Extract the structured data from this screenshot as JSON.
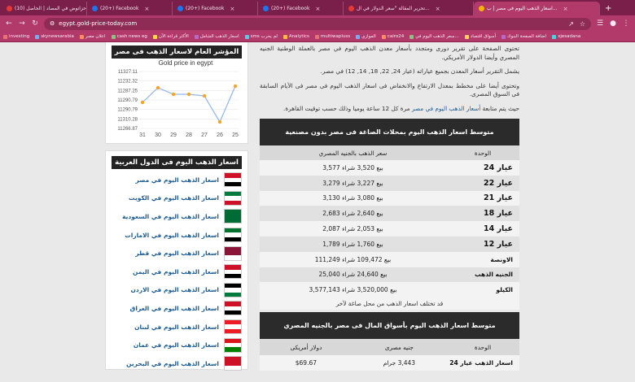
{
  "browser": {
    "tabs": [
      {
        "label": "(10) حزاتوض في المصاد | الحاصل...",
        "color": "#e53935"
      },
      {
        "label": "(20+) Facebook",
        "color": "#1877f2"
      },
      {
        "label": "(20+) Facebook",
        "color": "#1877f2"
      },
      {
        "label": "(20+) Facebook",
        "color": "#1877f2"
      },
      {
        "label": "تحرير المقالة \"سعر الدولار في ال...",
        "color": "#e53935"
      },
      {
        "label": "اسعار الذهب اليوم فى مصر | ب...",
        "color": "#f5b300"
      }
    ],
    "url": "egypt.gold-price-today.com",
    "bookmarks": [
      "investing",
      "skynewsarabia",
      "اعلان مصر",
      "cash news eg",
      "الأكثر قراءة الآن",
      "اسعار الذهب الشامل",
      "sms لم يحرب",
      "Analytics",
      "multiwapluss",
      "الموازي",
      "cairo24",
      "سعر الذهب اليوم في...",
      "أسواق اقتصاد",
      "اضافة الصفحة البنوك",
      "xjesadana"
    ]
  },
  "sidebar": {
    "chart_card_title": "المؤشر العام لاسعار الذهب فى مصر",
    "countries_title": "اسعار الذهب اليوم فى الدول العربية",
    "countries": [
      {
        "label": "اسعار الذهب اليوم في مصر",
        "flag": [
          "#ce1126",
          "#ffffff",
          "#000000"
        ]
      },
      {
        "label": "اسعار الذهب اليوم في الكويت",
        "flag": [
          "#007a3d",
          "#ffffff",
          "#ce1126"
        ]
      },
      {
        "label": "اسعار الذهب اليوم في السعودية",
        "flag": [
          "#006c35",
          "#006c35",
          "#006c35"
        ]
      },
      {
        "label": "اسعار الذهب اليوم في الامارات",
        "flag": [
          "#00732f",
          "#ffffff",
          "#000000"
        ]
      },
      {
        "label": "اسعار الذهب اليوم في قطر",
        "flag": [
          "#8a1538",
          "#8a1538",
          "#ffffff"
        ]
      },
      {
        "label": "اسعار الذهب اليوم في اليمن",
        "flag": [
          "#ce1126",
          "#ffffff",
          "#000000"
        ]
      },
      {
        "label": "اسعار الذهب اليوم في الاردن",
        "flag": [
          "#000000",
          "#ffffff",
          "#007a3d"
        ]
      },
      {
        "label": "اسعار الذهب اليوم في العراق",
        "flag": [
          "#ce1126",
          "#ffffff",
          "#000000"
        ]
      },
      {
        "label": "اسعار الذهب اليوم في لبنان",
        "flag": [
          "#ed1c24",
          "#ffffff",
          "#ed1c24"
        ]
      },
      {
        "label": "اسعار الذهب اليوم في عمان",
        "flag": [
          "#db161b",
          "#ffffff",
          "#008000"
        ]
      },
      {
        "label": "اسعار الذهب اليوم في البحرين",
        "flag": [
          "#ce1126",
          "#ce1126",
          "#ffffff"
        ]
      }
    ]
  },
  "chart_data": {
    "type": "line",
    "title": "Gold price in egypt",
    "x": [
      "31",
      "30",
      "29",
      "28",
      "27",
      "26",
      "25"
    ],
    "values": [
      11292,
      11310,
      11302,
      11302,
      11300,
      11268,
      11312
    ],
    "yticks": [
      "11327.11",
      "11232.32",
      "11287.25",
      "11290.79",
      "11290.79",
      "11310.28",
      "11266.87"
    ],
    "ylim": [
      11260,
      11330
    ],
    "grid": true,
    "color": "#f5a623"
  },
  "main": {
    "paragraphs": [
      "تحتوى الصفحة على تقرير دورى ومتجدد بأسعار معدن الذهب اليوم في مصر بالعملة الوطنية الجنيه المصري وأيضا الدولار الأمريكي.",
      "يشمل التقرير أسعار المعدن بجميع عياراته (عيار 24, 22, 18, 14, 12) في مصر.",
      "وتحتوى أيضا على مخطط بمعدل الارتفاع والانخفاض فى اسعار الذهب اليوم فى مصر فى الأيام السابقة فى السوق المصرى.",
      "حيث يتم متابعة"
    ],
    "link_text": "أسعار الذهب اليوم في مصر",
    "para_tail": "مرة كل 12 ساعة يوميا وذلك حسب توقيت القاهرة.",
    "table1_title": "متوسط اسعار الذهب اليوم بمحلات الصاغة فى مصر بدون مصنعية",
    "table1_headers": [
      "الوحدة",
      "سعر الذهب بالجنيه المصري"
    ],
    "table1_rows": [
      {
        "unit": "عيار 24",
        "price": "بيع 3,520 شراء 3,577"
      },
      {
        "unit": "عيار 22",
        "price": "بيع 3,227 شراء 3,279"
      },
      {
        "unit": "عيار 21",
        "price": "بيع 3,080 شراء 3,130"
      },
      {
        "unit": "عيار 18",
        "price": "بيع 2,640 شراء 2,683"
      },
      {
        "unit": "عيار 14",
        "price": "بيع 2,053 شراء 2,087"
      },
      {
        "unit": "عيار 12",
        "price": "بيع 1,760 شراء 1,789"
      },
      {
        "unit": "الاونصة",
        "price": "بيع 109,472 شراء 111,249"
      },
      {
        "unit": "الجنيه الذهب",
        "price": "بيع 24,640 شراء 25,040"
      },
      {
        "unit": "الكيلو",
        "price": "بيع 3,520,000 شراء 3,577,143"
      }
    ],
    "note": "قد تختلف اسعار الذهب من محل صاغة لآخر",
    "table2_title": "متوسط اسعار الذهب اليوم بأسواق المال فى مصر بالجنيه المصري",
    "table2_headers": [
      "الوحدة",
      "جنيه مصرى",
      "دولار أمريكى"
    ],
    "table2_rows": [
      {
        "unit": "اسعار الذهب عيار 24",
        "egp": "3,443 جرام",
        "usd": "$69.67"
      }
    ]
  }
}
